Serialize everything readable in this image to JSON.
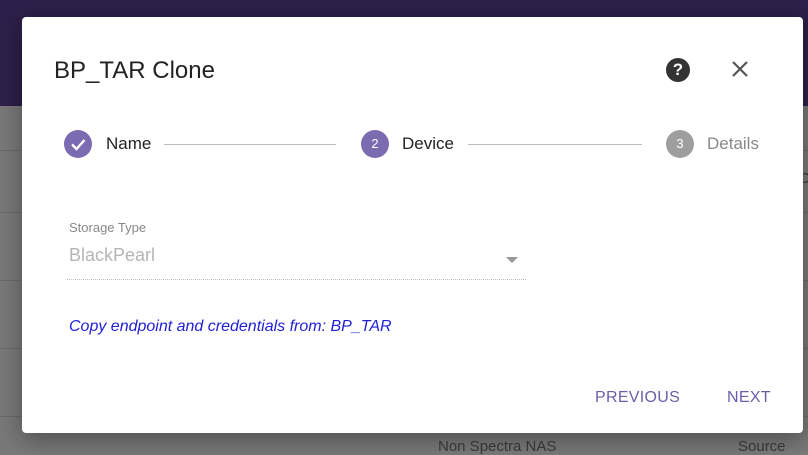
{
  "background": {
    "text_1": "Non Spectra NAS",
    "text_2": "Source",
    "text_3": "C"
  },
  "dialog": {
    "title": "BP_TAR Clone",
    "help_icon": "?",
    "close_icon": "close-icon"
  },
  "stepper": {
    "steps": [
      {
        "number": "✓",
        "label": "Name",
        "state": "completed"
      },
      {
        "number": "2",
        "label": "Device",
        "state": "active"
      },
      {
        "number": "3",
        "label": "Details",
        "state": "inactive"
      }
    ]
  },
  "form": {
    "storage_type_label": "Storage Type",
    "storage_type_value": "BlackPearl",
    "copy_link": "Copy endpoint and credentials from: BP_TAR"
  },
  "actions": {
    "previous": "PREVIOUS",
    "next": "NEXT"
  },
  "colors": {
    "accent": "#7b6bb0",
    "inactive": "#9e9e9e",
    "link": "#1f1fd6",
    "header": "#2d1f49"
  }
}
